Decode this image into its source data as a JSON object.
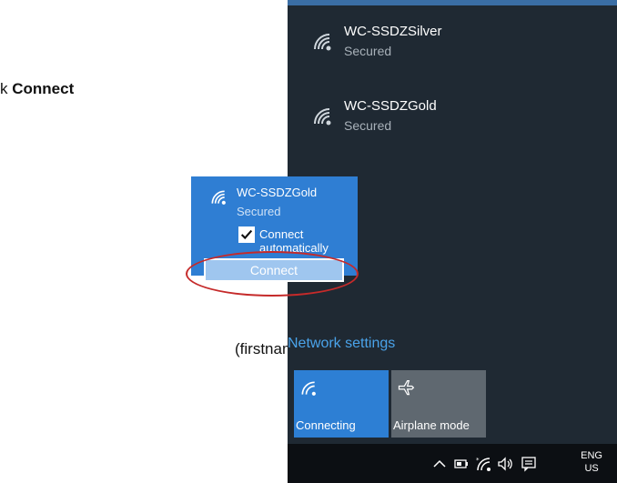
{
  "doc": {
    "line1_prefix": "k ",
    "line1_bold": "Connect",
    "line2": "(firstname.lastname) and"
  },
  "flyout": {
    "networks": [
      {
        "name": "WC-SSDZSilver",
        "status": "Secured",
        "icon": "wifi-icon"
      },
      {
        "name": "WC-SSDZGold",
        "status": "Secured",
        "icon": "wifi-icon"
      }
    ],
    "network_settings": "Network settings",
    "tiles": [
      {
        "label": "Connecting",
        "icon": "wifi-icon",
        "color": "#2d7fd4"
      },
      {
        "label": "Airplane mode",
        "icon": "airplane-icon",
        "color": "#5f6870"
      }
    ],
    "taskbar": {
      "lang_top": "ENG",
      "lang_bottom": "US"
    }
  },
  "popup": {
    "name": "WC-SSDZGold",
    "status": "Secured",
    "auto_label": "Connect automatically",
    "auto_checked": true,
    "connect_label": "Connect"
  },
  "colors": {
    "flyout_bg": "#1f2933",
    "accent": "#2f7ed3",
    "link": "#4aa3ea",
    "highlight_ring": "#c52a2a"
  }
}
